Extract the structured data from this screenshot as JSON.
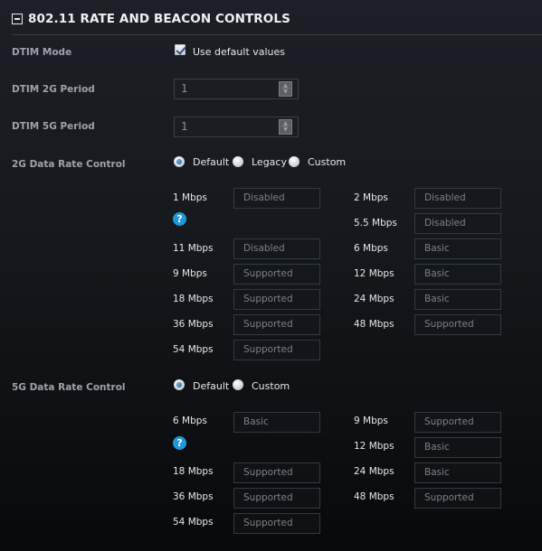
{
  "section": {
    "title": "802.11 RATE AND BEACON CONTROLS",
    "collapse_icon": "minus-square-icon"
  },
  "dtim_mode": {
    "label": "DTIM Mode",
    "checkbox_label": "Use default values",
    "checked": true
  },
  "dtim_2g": {
    "label": "DTIM 2G Period",
    "value": "1"
  },
  "dtim_5g": {
    "label": "DTIM 5G Period",
    "value": "1"
  },
  "spinner": {
    "up": "▲",
    "down": "▼"
  },
  "rate_2g": {
    "label": "2G Data Rate Control",
    "options": [
      "Default",
      "Legacy",
      "Custom"
    ],
    "selected": "Default",
    "help_icon": "?",
    "rates": [
      {
        "rate": "1 Mbps",
        "value": "Disabled"
      },
      {
        "rate": "2 Mbps",
        "value": "Disabled"
      },
      {
        "rate": "5.5 Mbps",
        "value": "Disabled"
      },
      {
        "rate": "11 Mbps",
        "value": "Disabled"
      },
      {
        "rate": "6 Mbps",
        "value": "Basic"
      },
      {
        "rate": "9 Mbps",
        "value": "Supported"
      },
      {
        "rate": "12 Mbps",
        "value": "Basic"
      },
      {
        "rate": "18 Mbps",
        "value": "Supported"
      },
      {
        "rate": "24 Mbps",
        "value": "Basic"
      },
      {
        "rate": "36 Mbps",
        "value": "Supported"
      },
      {
        "rate": "48 Mbps",
        "value": "Supported"
      },
      {
        "rate": "54 Mbps",
        "value": "Supported"
      }
    ]
  },
  "rate_5g": {
    "label": "5G Data Rate Control",
    "options": [
      "Default",
      "Custom"
    ],
    "selected": "Default",
    "help_icon": "?",
    "rates": [
      {
        "rate": "6 Mbps",
        "value": "Basic"
      },
      {
        "rate": "9 Mbps",
        "value": "Supported"
      },
      {
        "rate": "12 Mbps",
        "value": "Basic"
      },
      {
        "rate": "18 Mbps",
        "value": "Supported"
      },
      {
        "rate": "24 Mbps",
        "value": "Basic"
      },
      {
        "rate": "36 Mbps",
        "value": "Supported"
      },
      {
        "rate": "48 Mbps",
        "value": "Supported"
      },
      {
        "rate": "54 Mbps",
        "value": "Supported"
      }
    ]
  }
}
